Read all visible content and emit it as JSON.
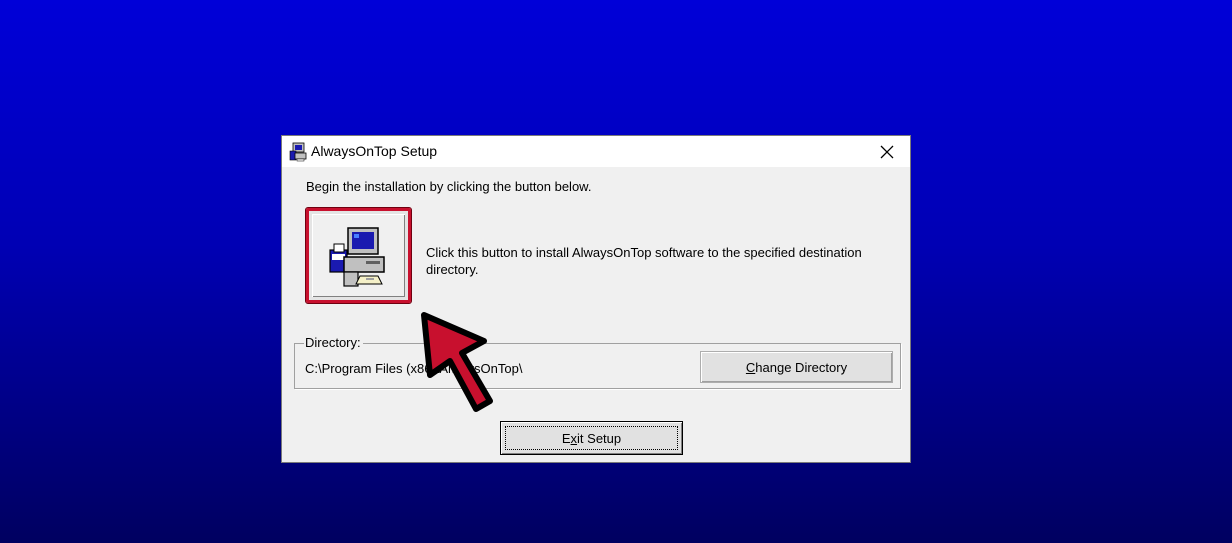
{
  "window": {
    "title": "AlwaysOnTop Setup",
    "title_icon": "setup-computer-icon",
    "close_icon": "close-icon"
  },
  "content": {
    "intro": "Begin the installation by clicking the button below.",
    "install_button_icon": "setup-computer-icon",
    "install_description": "Click this button to install AlwaysOnTop software to the specified destination directory."
  },
  "directory": {
    "label": "Directory:",
    "path": "C:\\Program Files (x86)\\AlwaysOnTop\\",
    "change_button": {
      "mnemonic": "C",
      "rest": "hange Directory"
    }
  },
  "exit_button": {
    "before": "E",
    "mnemonic": "x",
    "rest": "it Setup"
  },
  "overlay": {
    "pointer": "arrow-pointer-icon",
    "pointer_color": "#c8102e",
    "highlight_color": "#c8102e"
  }
}
